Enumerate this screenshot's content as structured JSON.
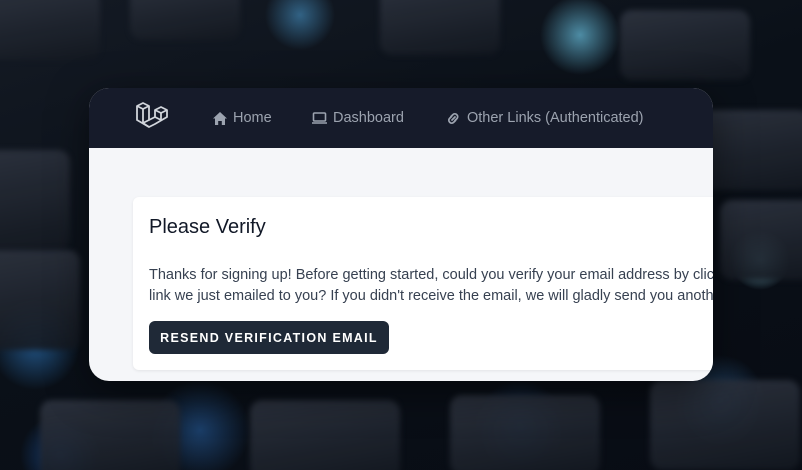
{
  "nav": {
    "logo_icon": "laravel-logo-icon",
    "items": [
      {
        "label": "Home",
        "icon": "home-icon"
      },
      {
        "label": "Dashboard",
        "icon": "laptop-icon"
      },
      {
        "label": "Other Links (Authenticated)",
        "icon": "link-icon"
      }
    ]
  },
  "verify": {
    "title": "Please Verify",
    "message": "Thanks for signing up! Before getting started, could you verify your email address by clicking on the link we just emailed to you? If you didn't receive the email, we will gladly send you another.",
    "button_label": "RESEND VERIFICATION EMAIL"
  },
  "colors": {
    "nav_bg": "#161b2a",
    "nav_text": "#9ca3af",
    "button_bg": "#1f2937",
    "page_bg": "#f5f6f9"
  }
}
